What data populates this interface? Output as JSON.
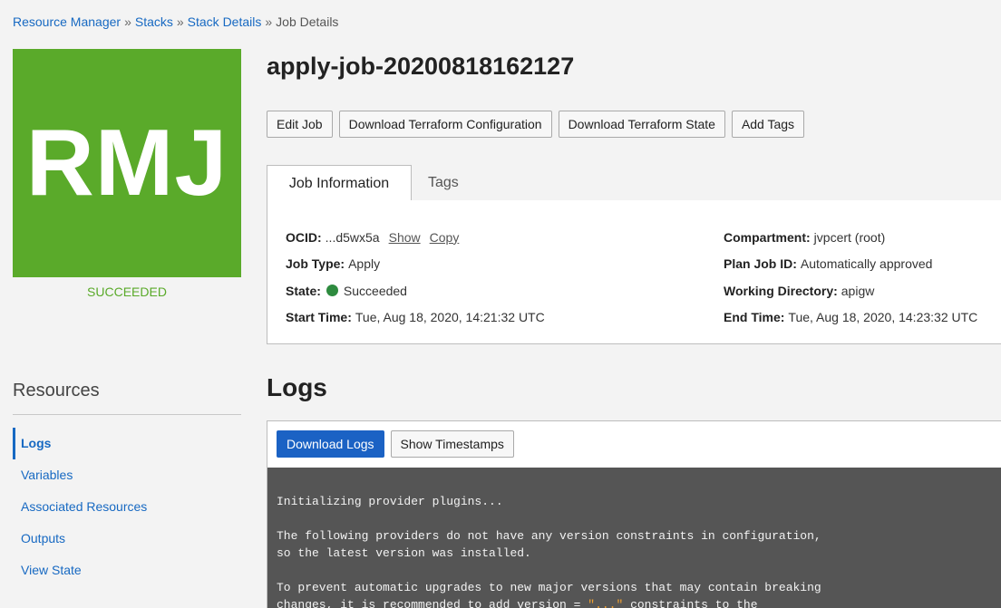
{
  "breadcrumb": {
    "items": [
      "Resource Manager",
      "Stacks",
      "Stack Details"
    ],
    "current": "Job Details",
    "separator": "»"
  },
  "badge": {
    "initials": "RMJ",
    "status": "SUCCEEDED",
    "color": "#5aaa2a"
  },
  "job": {
    "title": "apply-job-20200818162127"
  },
  "actions": {
    "edit": "Edit Job",
    "download_config": "Download Terraform Configuration",
    "download_state": "Download Terraform State",
    "add_tags": "Add Tags"
  },
  "tabs": {
    "info": "Job Information",
    "tags": "Tags"
  },
  "info": {
    "ocid_label": "OCID:",
    "ocid_value": "...d5wx5a",
    "show": "Show",
    "copy": "Copy",
    "job_type_label": "Job Type:",
    "job_type_value": "Apply",
    "state_label": "State:",
    "state_value": "Succeeded",
    "start_label": "Start Time:",
    "start_value": "Tue, Aug 18, 2020, 14:21:32 UTC",
    "compartment_label": "Compartment:",
    "compartment_value": "jvpcert (root)",
    "plan_label": "Plan Job ID:",
    "plan_value": "Automatically approved",
    "workdir_label": "Working Directory:",
    "workdir_value": "apigw",
    "end_label": "End Time:",
    "end_value": "Tue, Aug 18, 2020, 14:23:32 UTC"
  },
  "resources": {
    "title": "Resources",
    "items": [
      "Logs",
      "Variables",
      "Associated Resources",
      "Outputs",
      "View State"
    ]
  },
  "logs": {
    "title": "Logs",
    "download": "Download Logs",
    "timestamps": "Show Timestamps",
    "lines": [
      "Initializing provider plugins...",
      "",
      "The following providers do not have any version constraints in configuration,",
      "so the latest version was installed.",
      "",
      "To prevent automatic upgrades to new major versions that may contain breaking"
    ],
    "last_line_start": "changes, it is recommended to add version = ",
    "last_line_quote": "\"...\"",
    "last_line_end": " constraints to the"
  }
}
